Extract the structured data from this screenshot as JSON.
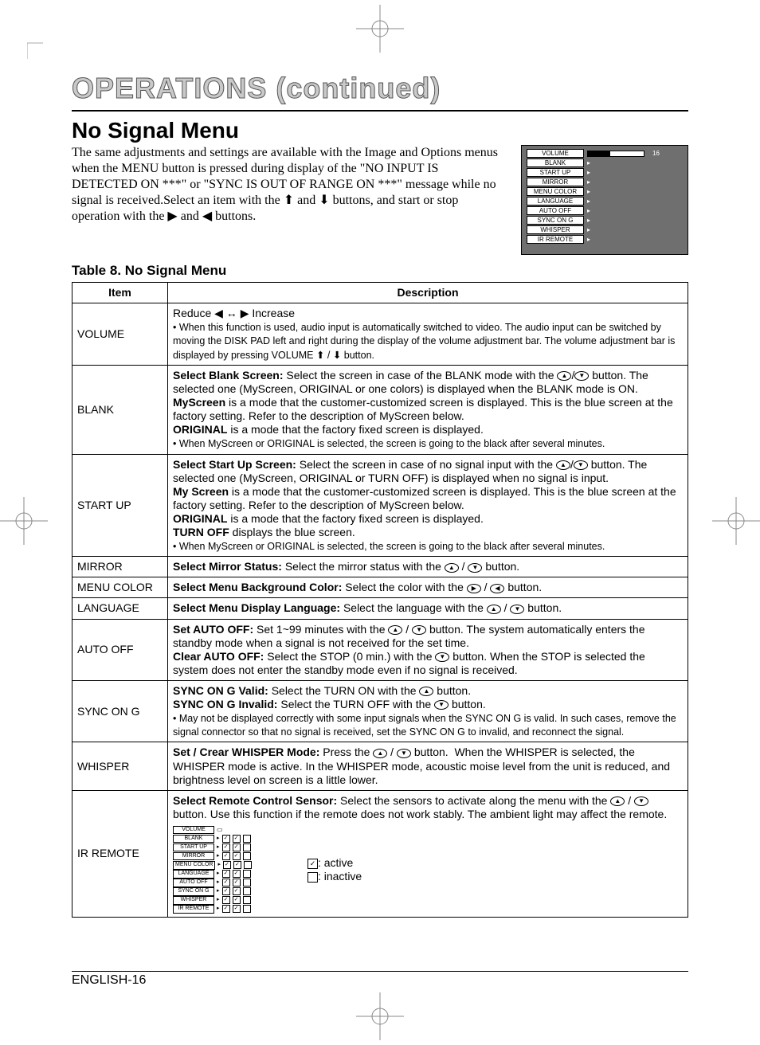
{
  "page_title": "OPERATIONS (continued)",
  "section_title": "No Signal Menu",
  "intro_text": "The same adjustments and settings are available with the Image and Options menus when the MENU button is pressed during display of the \"NO INPUT IS DETECTED ON ***\" or \"SYNC IS OUT OF RANGE ON ***\" message while no signal is received.Select an item with the ⬆ and ⬇ buttons, and start or stop operation with the ▶ and ◀ buttons.",
  "table_caption": "Table 8. No Signal Menu",
  "footer": "ENGLISH-16",
  "osd": {
    "items": [
      "VOLUME",
      "BLANK",
      "START UP",
      "MIRROR",
      "MENU COLOR",
      "LANGUAGE",
      "AUTO OFF",
      "SYNC ON G",
      "WHISPER",
      "IR REMOTE"
    ],
    "value": "16"
  },
  "table": {
    "head_item": "Item",
    "head_desc": "Description",
    "rows": [
      {
        "item": "VOLUME",
        "desc_html": "Reduce ◀ ↔ ▶ Increase<br><span class='small'>• When this function is used, audio input is automatically switched to video. The audio input can be switched by moving the DISK PAD left and right during the display of the volume adjustment bar. The volume adjustment bar is displayed by pressing VOLUME ⬆ / ⬇ button.</span>"
      },
      {
        "item": "BLANK",
        "desc_html": "<span class='b'>Select Blank Screen:</span> Select the screen in case of the BLANK mode with the <span class='circ'>▲</span>/<span class='circ'>▼</span> button. The selected one (MyScreen, ORIGINAL or one colors) is displayed when the BLANK mode is ON.<br><span class='b'>MyScreen</span> is a mode that the customer-customized screen is displayed. This is the blue screen at the factory setting. Refer to the description of MyScreen below.<br><span class='b'>ORIGINAL</span> is a mode that the factory fixed screen is displayed.<br><span class='small'>• When MyScreen or ORIGINAL is selected, the screen is going to the black after several minutes.</span>"
      },
      {
        "item": "START UP",
        "desc_html": "<span class='b'>Select Start Up Screen:</span> Select the screen in case of no signal input with the <span class='circ'>▲</span>/<span class='circ'>▼</span> button. The selected one (MyScreen, ORIGINAL or TURN OFF) is displayed when no signal is input.<br><span class='b'>My Screen</span> is a mode that the customer-customized screen is displayed. This is the blue screen at the factory setting. Refer to the description of MyScreen below.<br><span class='b'>ORIGINAL</span> is a mode that the factory fixed screen is displayed.<br><span class='b'>TURN OFF</span> displays the blue screen.<br><span class='small'>• When MyScreen or ORIGINAL is selected, the screen is going to the black after several minutes.</span>"
      },
      {
        "item": "MIRROR",
        "desc_html": "<span class='b'>Select Mirror Status:</span> Select the mirror status with the <span class='circ'>▲</span> / <span class='circ'>▼</span> button."
      },
      {
        "item": "MENU COLOR",
        "desc_html": "<span class='b'>Select Menu Background Color:</span> Select the color with the <span class='circ'>▶</span> / <span class='circ'>◀</span> button."
      },
      {
        "item": "LANGUAGE",
        "desc_html": "<span class='b'>Select Menu Display Language:</span> Select the language with the <span class='circ'>▲</span> / <span class='circ'>▼</span> button."
      },
      {
        "item": "AUTO OFF",
        "desc_html": "<span class='b'>Set AUTO OFF:</span> Set 1~99 minutes with the <span class='circ'>▲</span> / <span class='circ'>▼</span> button. The system automatically enters the standby mode when a signal is not received for the set time.<br><span class='b'>Clear AUTO OFF:</span> Select the STOP (0 min.) with the <span class='circ'>▼</span> button. When the STOP is selected the system does not enter the standby mode even if no signal is received."
      },
      {
        "item": "SYNC ON G",
        "desc_html": "<span class='b'>SYNC ON G Valid:</span> Select the TURN ON with the <span class='circ'>▲</span> button.<br><span class='b'>SYNC ON G Invalid:</span> Select the TURN OFF with the <span class='circ'>▼</span> button.<br><span class='small'>• May not be displayed correctly with some input signals when the SYNC ON G is valid. In such cases, remove the signal connector so that no signal is received, set the SYNC ON G to invalid, and reconnect the signal.</span>"
      },
      {
        "item": "WHISPER",
        "desc_html": "<span class='b'>Set / Crear WHISPER Mode:</span> Press the <span class='circ'>▲</span> / <span class='circ'>▼</span> button.&nbsp; When the WHISPER is selected, the WHISPER mode is active. In the WHISPER mode, acoustic moise level from the unit is reduced, and brightness level on screen is a little lower."
      },
      {
        "item": "IR REMOTE",
        "desc_html": "<span class='b'>Select Remote Control Sensor:</span> Select the sensors to activate along the menu with the <span class='circ'>▲</span> / <span class='circ'>▼</span> button. Use this function if the remote does not work stably. The ambient light may affect the remote.",
        "has_ir_osd": true
      }
    ]
  },
  "ir_legend_active": ": active",
  "ir_legend_inactive": ": inactive"
}
